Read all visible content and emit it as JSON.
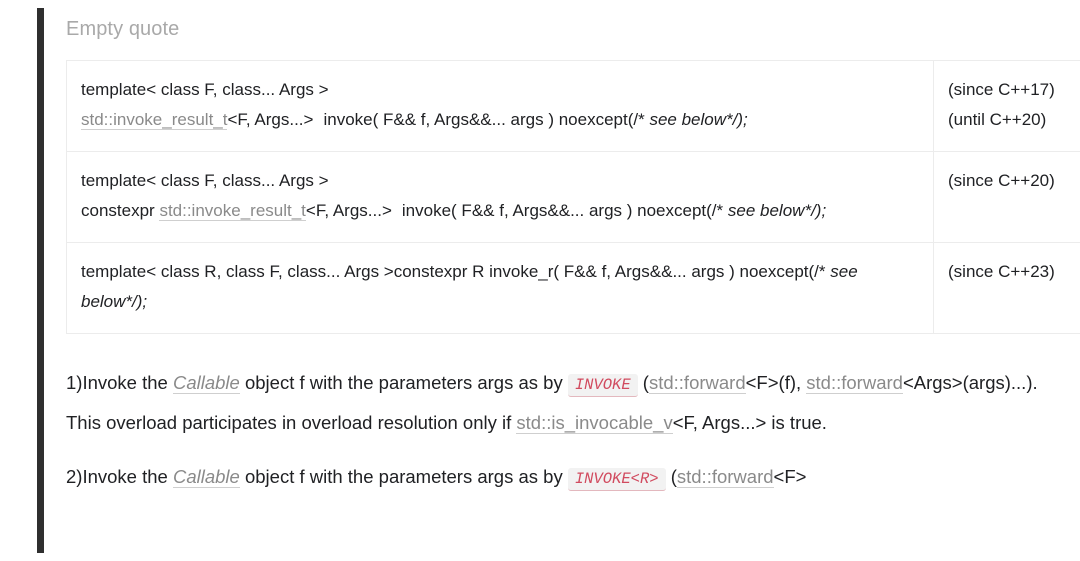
{
  "quote": {
    "caption": "Empty quote",
    "bar_color": "#2f2f2f"
  },
  "signature_table": {
    "border_color": "#ececec",
    "rows": [
      {
        "signature_parts": {
          "line1": "template< class F, class... Args >",
          "link": "std::invoke_result_t",
          "after_link": "<F, Args...>",
          "mid": "invoke( F&& f, Args&&... args ) noexcept(/*",
          "italic": "see below",
          "tail": "*/);",
          "prefix": ""
        },
        "since": [
          "(since C++17)",
          "(until C++20)"
        ]
      },
      {
        "signature_parts": {
          "line1": "template< class F, class... Args >",
          "prefix": "constexpr ",
          "link": "std::invoke_result_t",
          "after_link": "<F, Args...>",
          "mid": "invoke( F&& f, Args&&... args ) noexcept(/*",
          "italic": "see below",
          "tail": "*/);"
        },
        "since": [
          "(since C++20)"
        ]
      },
      {
        "signature_parts": {
          "line1": "template< class R, class F, class... Args >constexpr R invoke_r( F&& f, Args&&... args ) noexcept(/*",
          "italic": "see below",
          "tail": "*/);",
          "prefix": "",
          "link": "",
          "after_link": "",
          "mid": ""
        },
        "since": [
          "(since C++23)"
        ]
      }
    ]
  },
  "prose": {
    "item1": {
      "number": "1)",
      "t1": "Invoke the ",
      "callable": "Callable",
      "t2": " object f with the parameters args as by ",
      "code": "INVOKE",
      "t3": " (",
      "forward1": "std::forward",
      "t4": "<F>(f), ",
      "forward2": "std::forward",
      "t5": "<Args>(args)...). This overload participates in overload resolution only if ",
      "invocable": "std::is_invocable_v",
      "t6": "<F, Args...> is true."
    },
    "item2": {
      "number": "2)",
      "t1": "Invoke the ",
      "callable": "Callable",
      "t2": " object f with the parameters args as by ",
      "code": "INVOKE<R>",
      "t3": " (",
      "forward1": "std::forward",
      "t4": "<F>"
    }
  }
}
